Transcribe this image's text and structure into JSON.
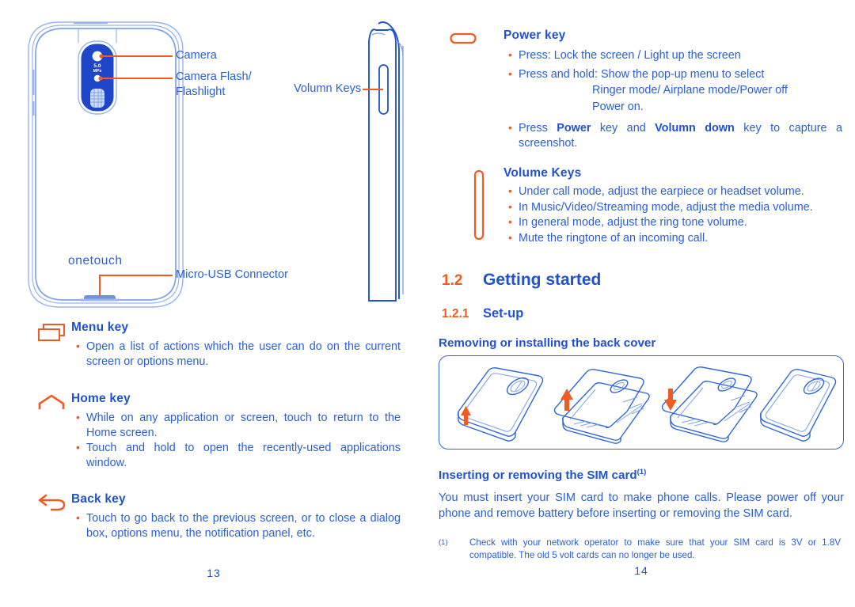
{
  "document": {
    "left_page_number": "13",
    "right_page_number": "14"
  },
  "colors": {
    "blue": "#1f52d0",
    "body_blue": "#2a5fd4",
    "orange": "#f15a22",
    "line_blue": "#2f66d8"
  },
  "diagram": {
    "brand_logo": "onetouch",
    "camera_spec_line1": "5.0",
    "camera_spec_line2": "MPx",
    "callouts": [
      {
        "name": "camera",
        "text": "Camera"
      },
      {
        "name": "camera-flash",
        "text": "Camera Flash/"
      },
      {
        "name": "flashlight",
        "text": "Flashlight"
      },
      {
        "name": "volume-keys",
        "text": "Volumn Keys"
      },
      {
        "name": "micro-usb",
        "text": "Micro-USB Connector"
      }
    ]
  },
  "left_column": {
    "keys": [
      {
        "icon": "menu-key-icon",
        "title": "Menu key",
        "bullets": [
          "Open a list of actions which the user can do on the current screen or options menu."
        ]
      },
      {
        "icon": "home-key-icon",
        "title": "Home key",
        "bullets": [
          "While on any application or screen,  touch to return to the Home screen.",
          "Touch and hold to open the recently-used applications window."
        ]
      },
      {
        "icon": "back-key-icon",
        "title": "Back key",
        "bullets": [
          "Touch to go back to the previous screen, or to close a dialog box, options menu, the notification panel, etc."
        ]
      }
    ]
  },
  "right_column": {
    "power_key": {
      "icon": "power-key-icon",
      "title": "Power  key",
      "bullets": [
        "Press: Lock the screen / Light up the screen",
        "Press and hold: Show the pop-up menu to select",
        "Press "
      ],
      "indented_lines": [
        "Ringer mode/ Airplane mode/Power off",
        "Power on."
      ],
      "screenshot_bullet": {
        "pre": "Press ",
        "bold1": "Power",
        "mid1": " key and ",
        "bold2": "Volumn down",
        "post": " key to capture a screenshot."
      }
    },
    "volume_keys": {
      "icon": "volume-keys-icon",
      "title": "Volume Keys",
      "bullets": [
        "Under call mode, adjust the earpiece or headset volume.",
        "In Music/Video/Streaming mode, adjust the media volume.",
        "In general mode, adjust the ring tone volume.",
        "Mute the ringtone of an incoming call."
      ]
    },
    "section_getting_started": {
      "number": "1.2",
      "title": "Getting started"
    },
    "section_setup": {
      "number": "1.2.1",
      "title": "Set-up"
    },
    "back_cover_heading": "Removing or installing the back cover",
    "sim_heading": "Inserting or removing the SIM card",
    "sim_heading_footnote_mark": "(1)",
    "sim_paragraph": "You must insert your SIM card to make phone calls. Please power off your phone and remove battery before inserting or removing the SIM card.",
    "footnote": {
      "mark": "(1)",
      "text": "Check with your network operator to make sure that your SIM card is 3V or 1.8V compatible. The old 5 volt cards can no longer be used."
    }
  }
}
